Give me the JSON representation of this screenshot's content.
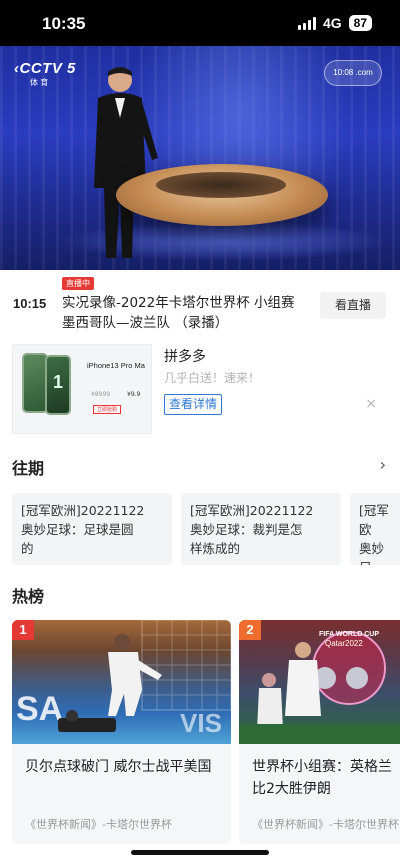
{
  "status_bar": {
    "time": "10:35",
    "network": "4G",
    "battery": "87"
  },
  "video": {
    "channel_logo": "CCTV 5",
    "channel_sub": "体 育",
    "corner_logo": "10:08 .com"
  },
  "live": {
    "time": "10:15",
    "badge": "直播中",
    "title": "实况录像-2022年卡塔尔世界杯 小组赛 墨西哥队—波兰队 （录播）",
    "watch_button": "看直播"
  },
  "ad": {
    "product_model": "iPhone13 Pro Ma",
    "price_a": "¥8999",
    "price_b": "¥9.9",
    "buy_label": "立即抢购",
    "brand": "拼多多",
    "slogan": "几乎白送！速来！",
    "details_button": "查看详情",
    "close": "×"
  },
  "past": {
    "heading": "往期",
    "arrow": "›",
    "items": [
      {
        "text": "[冠军欧洲]20221122\n奥妙足球：足球是圆\n的"
      },
      {
        "text": "[冠军欧洲]20221122\n奥妙足球：裁判是怎\n样炼成的"
      },
      {
        "text": "[冠军欧\n奥妙足"
      }
    ]
  },
  "hot": {
    "heading": "热榜",
    "items": [
      {
        "rank": "1",
        "title": "贝尔点球破门 威尔士战平美国",
        "source": "《世界杯新闻》-卡塔尔世界杯",
        "rank_color": "#e53935"
      },
      {
        "rank": "2",
        "title": "世界杯小组赛：英格兰比2大胜伊朗",
        "source": "《世界杯新闻》-卡塔尔世界杯",
        "rank_color": "#ef6c2f"
      }
    ]
  }
}
